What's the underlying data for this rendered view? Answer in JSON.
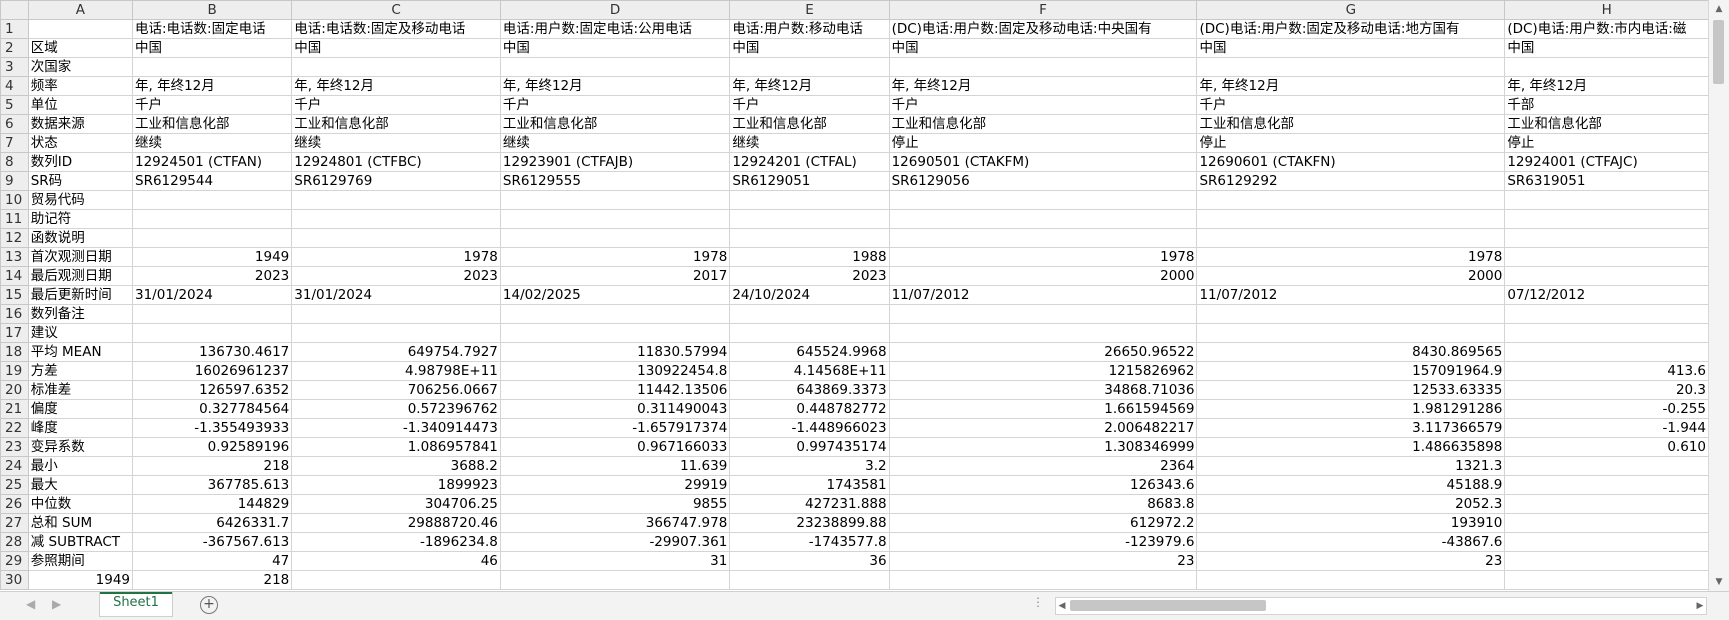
{
  "columns": [
    "A",
    "B",
    "C",
    "D",
    "E",
    "F",
    "G",
    "H"
  ],
  "rows": [
    {
      "n": "1",
      "cells": [
        "",
        "电话:电话数:固定电话",
        "电话:电话数:固定及移动电话",
        "电话:用户数:固定电话:公用电话",
        "电话:用户数:移动电话",
        "(DC)电话:用户数:固定及移动电话:中央国有",
        "(DC)电话:用户数:固定及移动电话:地方国有",
        "(DC)电话:用户数:市内电话:磁"
      ]
    },
    {
      "n": "2",
      "cells": [
        "区域",
        "中国",
        "中国",
        "中国",
        "中国",
        "中国",
        "中国",
        "中国"
      ]
    },
    {
      "n": "3",
      "cells": [
        "次国家",
        "",
        "",
        "",
        "",
        "",
        "",
        ""
      ]
    },
    {
      "n": "4",
      "cells": [
        "频率",
        "年, 年终12月",
        "年, 年终12月",
        "年, 年终12月",
        "年, 年终12月",
        "年, 年终12月",
        "年, 年终12月",
        "年, 年终12月"
      ]
    },
    {
      "n": "5",
      "cells": [
        "单位",
        "千户",
        "千户",
        "千户",
        "千户",
        "千户",
        "千户",
        "千部"
      ]
    },
    {
      "n": "6",
      "cells": [
        "数据来源",
        "工业和信息化部",
        "工业和信息化部",
        "工业和信息化部",
        "工业和信息化部",
        "工业和信息化部",
        "工业和信息化部",
        "工业和信息化部"
      ]
    },
    {
      "n": "7",
      "cells": [
        "状态",
        "继续",
        "继续",
        "继续",
        "继续",
        "停止",
        "停止",
        "停止"
      ]
    },
    {
      "n": "8",
      "cells": [
        "数列ID",
        "12924501 (CTFAN)",
        "12924801 (CTFBC)",
        "12923901 (CTFAJB)",
        "12924201 (CTFAL)",
        "12690501 (CTAKFM)",
        "12690601 (CTAKFN)",
        "12924001 (CTFAJC)"
      ]
    },
    {
      "n": "9",
      "cells": [
        "SR码",
        "SR6129544",
        "SR6129769",
        "SR6129555",
        "SR6129051",
        "SR6129056",
        "SR6129292",
        "SR6319051"
      ]
    },
    {
      "n": "10",
      "cells": [
        "贸易代码",
        "",
        "",
        "",
        "",
        "",
        "",
        ""
      ]
    },
    {
      "n": "11",
      "cells": [
        "助记符",
        "",
        "",
        "",
        "",
        "",
        "",
        ""
      ]
    },
    {
      "n": "12",
      "cells": [
        "函数说明",
        "",
        "",
        "",
        "",
        "",
        "",
        ""
      ]
    },
    {
      "n": "13",
      "cells": [
        "首次观测日期",
        "1949",
        "1978",
        "1978",
        "1988",
        "1978",
        "1978",
        ""
      ]
    },
    {
      "n": "14",
      "cells": [
        "最后观测日期",
        "2023",
        "2023",
        "2017",
        "2023",
        "2000",
        "2000",
        ""
      ]
    },
    {
      "n": "15",
      "cells": [
        "最后更新时间",
        "31/01/2024",
        "31/01/2024",
        "14/02/2025",
        "24/10/2024",
        "11/07/2012",
        "11/07/2012",
        "07/12/2012"
      ]
    },
    {
      "n": "16",
      "cells": [
        "数列备注",
        "",
        "",
        "",
        "",
        "",
        "",
        ""
      ]
    },
    {
      "n": "17",
      "cells": [
        "建议",
        "",
        "",
        "",
        "",
        "",
        "",
        ""
      ]
    },
    {
      "n": "18",
      "cells": [
        "平均 MEAN",
        "136730.4617",
        "649754.7927",
        "11830.57994",
        "645524.9968",
        "26650.96522",
        "8430.869565",
        ""
      ]
    },
    {
      "n": "19",
      "cells": [
        "方差",
        "16026961237",
        "4.98798E+11",
        "130922454.8",
        "4.14568E+11",
        "1215826962",
        "157091964.9",
        "413.6"
      ]
    },
    {
      "n": "20",
      "cells": [
        "标准差",
        "126597.6352",
        "706256.0667",
        "11442.13506",
        "643869.3373",
        "34868.71036",
        "12533.63335",
        "20.3"
      ]
    },
    {
      "n": "21",
      "cells": [
        "偏度",
        "0.327784564",
        "0.572396762",
        "0.311490043",
        "0.448782772",
        "1.661594569",
        "1.981291286",
        "-0.255"
      ]
    },
    {
      "n": "22",
      "cells": [
        "峰度",
        "-1.355493933",
        "-1.340914473",
        "-1.657917374",
        "-1.448966023",
        "2.006482217",
        "3.117366579",
        "-1.944"
      ]
    },
    {
      "n": "23",
      "cells": [
        "变异系数",
        "0.92589196",
        "1.086957841",
        "0.967166033",
        "0.997435174",
        "1.308346999",
        "1.486635898",
        "0.610"
      ]
    },
    {
      "n": "24",
      "cells": [
        "最小",
        "218",
        "3688.2",
        "11.639",
        "3.2",
        "2364",
        "1321.3",
        ""
      ]
    },
    {
      "n": "25",
      "cells": [
        "最大",
        "367785.613",
        "1899923",
        "29919",
        "1743581",
        "126343.6",
        "45188.9",
        ""
      ]
    },
    {
      "n": "26",
      "cells": [
        "中位数",
        "144829",
        "304706.25",
        "9855",
        "427231.888",
        "8683.8",
        "2052.3",
        ""
      ]
    },
    {
      "n": "27",
      "cells": [
        "总和 SUM",
        "6426331.7",
        "29888720.46",
        "366747.978",
        "23238899.88",
        "612972.2",
        "193910",
        ""
      ]
    },
    {
      "n": "28",
      "cells": [
        "减 SUBTRACT",
        "-367567.613",
        "-1896234.8",
        "-29907.361",
        "-1743577.8",
        "-123979.6",
        "-43867.6",
        ""
      ]
    },
    {
      "n": "29",
      "cells": [
        "参照期间",
        "47",
        "46",
        "31",
        "36",
        "23",
        "23",
        ""
      ]
    },
    {
      "n": "30",
      "cells": [
        "1949",
        "218",
        "",
        "",
        "",
        "",
        "",
        ""
      ]
    }
  ],
  "sheet_tab": "Sheet1",
  "add_sheet_symbol": "+",
  "nav_prev": "◀",
  "nav_next": "▶",
  "more_symbol": "⋮"
}
